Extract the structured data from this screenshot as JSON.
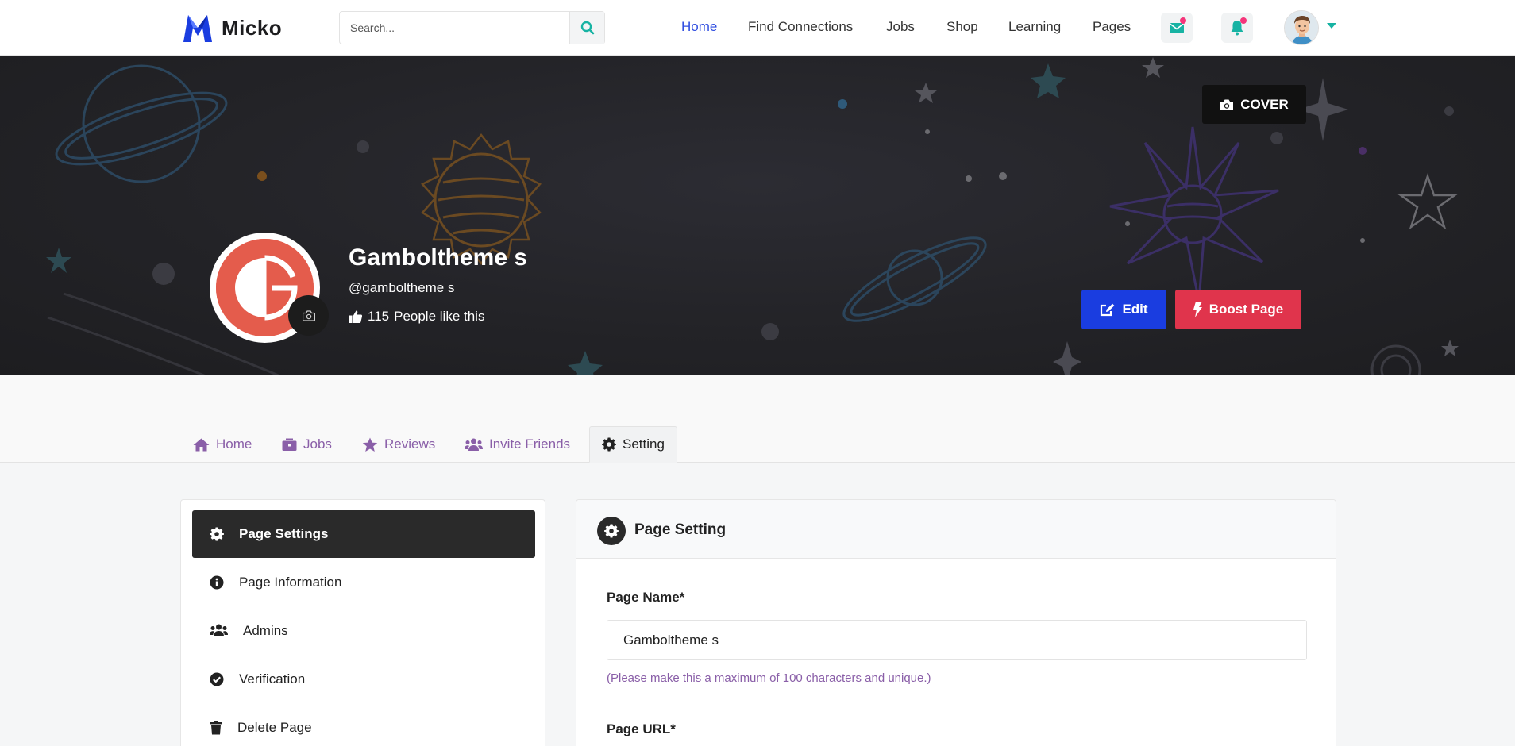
{
  "navbar": {
    "brand": "Micko",
    "search_placeholder": "Search...",
    "links": [
      {
        "label": "Home",
        "active": true
      },
      {
        "label": "Find Connections"
      },
      {
        "label": "Jobs"
      },
      {
        "label": "Shop"
      },
      {
        "label": "Learning"
      },
      {
        "label": "Pages"
      }
    ],
    "icons": [
      "envelope-icon",
      "bell-icon",
      "user-avatar",
      "caret-down-icon"
    ]
  },
  "cover": {
    "cover_button": "COVER",
    "page_name": "Gamboltheme s",
    "handle": "@gamboltheme s",
    "likes_count": "115",
    "likes_text": "People like this",
    "edit_button": "Edit",
    "boost_button": "Boost Page"
  },
  "tabs": [
    {
      "label": "Home",
      "icon": "home-icon"
    },
    {
      "label": "Jobs",
      "icon": "briefcase-icon"
    },
    {
      "label": "Reviews",
      "icon": "star-icon"
    },
    {
      "label": "Invite Friends",
      "icon": "users-icon"
    },
    {
      "label": "Setting",
      "icon": "gear-icon",
      "active": true
    }
  ],
  "side_menu": [
    {
      "label": "Page Settings",
      "icon": "gear-icon",
      "active": true
    },
    {
      "label": "Page Information",
      "icon": "info-icon"
    },
    {
      "label": "Admins",
      "icon": "users-icon"
    },
    {
      "label": "Verification",
      "icon": "check-circle-icon"
    },
    {
      "label": "Delete Page",
      "icon": "trash-icon"
    }
  ],
  "panel": {
    "title": "Page Setting",
    "page_name_label": "Page Name*",
    "page_name_value": "Gamboltheme s",
    "page_name_help": "(Please make this a maximum of 100 characters and unique.)",
    "page_url_label": "Page URL*"
  },
  "colors": {
    "accent_blue": "#1a3de0",
    "accent_red": "#e0344c",
    "tab_purple": "#8a5fa8",
    "teal": "#17b3a3"
  }
}
